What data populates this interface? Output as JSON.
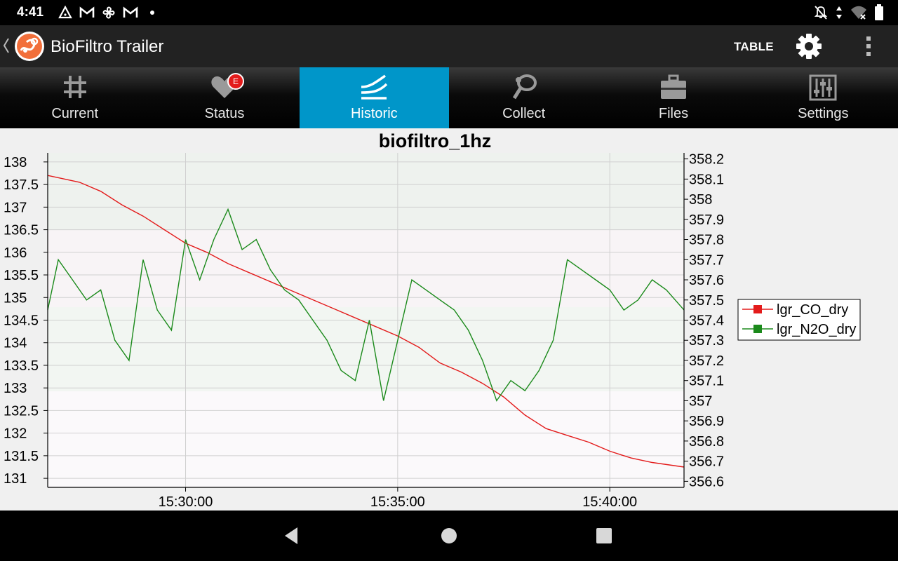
{
  "status_bar": {
    "time": "4:41",
    "left_icons": [
      "warning-triangle-icon",
      "gmail-icon",
      "pinwheel-icon",
      "gmail-icon",
      "dot-icon"
    ],
    "right_icons": [
      "notifications-off-icon",
      "data-arrows-icon",
      "wifi-off-icon",
      "battery-icon"
    ]
  },
  "app_bar": {
    "title": "BioFiltro Trailer",
    "table_label": "TABLE",
    "logo_color": "#f26f3a"
  },
  "tabs": [
    {
      "label": "Current",
      "icon": "grid-icon",
      "active": false
    },
    {
      "label": "Status",
      "icon": "heart-icon",
      "active": false,
      "badge": "E"
    },
    {
      "label": "Historic",
      "icon": "historic-wave-icon",
      "active": true
    },
    {
      "label": "Collect",
      "icon": "collect-icon",
      "active": false
    },
    {
      "label": "Files",
      "icon": "briefcase-icon",
      "active": false
    },
    {
      "label": "Settings",
      "icon": "sliders-icon",
      "active": false
    }
  ],
  "colors": {
    "accent": "#0096c9",
    "series_co": "#e31b1b",
    "series_n2o": "#1b8a1b",
    "badge": "#e31b1b"
  },
  "chart_data": {
    "type": "line",
    "title": "biofiltro_1hz",
    "x_range": [
      "15:26:45",
      "15:41:45"
    ],
    "x_ticks": [
      "15:30:00",
      "15:35:00",
      "15:40:00"
    ],
    "y_left": {
      "ylim": [
        130.8,
        138.2
      ],
      "ticks": [
        "131",
        "131.5",
        "132",
        "132.5",
        "133",
        "133.5",
        "134",
        "134.5",
        "135",
        "135.5",
        "136",
        "136.5",
        "137",
        "137.5",
        "138"
      ]
    },
    "y_right": {
      "ylim": [
        356.57,
        358.23
      ],
      "ticks": [
        "356.6",
        "356.7",
        "356.8",
        "356.9",
        "357",
        "357.1",
        "357.2",
        "357.3",
        "357.4",
        "357.5",
        "357.6",
        "357.7",
        "357.8",
        "357.9",
        "358",
        "358.1",
        "358.2"
      ]
    },
    "grid": true,
    "legend_position": "right",
    "series": [
      {
        "name": "lgr_CO_dry",
        "axis": "left",
        "color": "#e31b1b",
        "x": [
          "15:26:45",
          "15:27:30",
          "15:28:00",
          "15:28:30",
          "15:29:00",
          "15:29:30",
          "15:30:00",
          "15:30:30",
          "15:31:00",
          "15:31:30",
          "15:32:00",
          "15:32:30",
          "15:33:00",
          "15:33:30",
          "15:34:00",
          "15:34:30",
          "15:35:00",
          "15:35:30",
          "15:36:00",
          "15:36:30",
          "15:37:00",
          "15:37:30",
          "15:38:00",
          "15:38:30",
          "15:39:00",
          "15:39:30",
          "15:40:00",
          "15:40:30",
          "15:41:00",
          "15:41:45"
        ],
        "values": [
          137.7,
          137.55,
          137.35,
          137.05,
          136.8,
          136.5,
          136.2,
          136.0,
          135.75,
          135.55,
          135.35,
          135.15,
          134.95,
          134.75,
          134.55,
          134.35,
          134.15,
          133.9,
          133.55,
          133.35,
          133.1,
          132.8,
          132.4,
          132.1,
          131.95,
          131.8,
          131.6,
          131.45,
          131.35,
          131.25
        ]
      },
      {
        "name": "lgr_N2O_dry",
        "axis": "right",
        "color": "#1b8a1b",
        "x": [
          "15:26:45",
          "15:27:00",
          "15:27:20",
          "15:27:40",
          "15:28:00",
          "15:28:20",
          "15:28:40",
          "15:29:00",
          "15:29:20",
          "15:29:40",
          "15:30:00",
          "15:30:20",
          "15:30:40",
          "15:31:00",
          "15:31:20",
          "15:31:40",
          "15:32:00",
          "15:32:20",
          "15:32:40",
          "15:33:00",
          "15:33:20",
          "15:33:40",
          "15:34:00",
          "15:34:20",
          "15:34:40",
          "15:35:00",
          "15:35:20",
          "15:35:40",
          "15:36:00",
          "15:36:20",
          "15:36:40",
          "15:37:00",
          "15:37:20",
          "15:37:40",
          "15:38:00",
          "15:38:20",
          "15:38:40",
          "15:39:00",
          "15:39:20",
          "15:39:40",
          "15:40:00",
          "15:40:20",
          "15:40:40",
          "15:41:00",
          "15:41:20",
          "15:41:45"
        ],
        "values": [
          357.45,
          357.7,
          357.6,
          357.5,
          357.55,
          357.3,
          357.2,
          357.7,
          357.45,
          357.35,
          357.8,
          357.6,
          357.8,
          357.95,
          357.75,
          357.8,
          357.65,
          357.55,
          357.5,
          357.4,
          357.3,
          357.15,
          357.1,
          357.4,
          357.0,
          357.3,
          357.6,
          357.55,
          357.5,
          357.45,
          357.35,
          357.2,
          357.0,
          357.1,
          357.05,
          357.15,
          357.3,
          357.7,
          357.65,
          357.6,
          357.55,
          357.45,
          357.5,
          357.6,
          357.55,
          357.45
        ]
      }
    ]
  }
}
